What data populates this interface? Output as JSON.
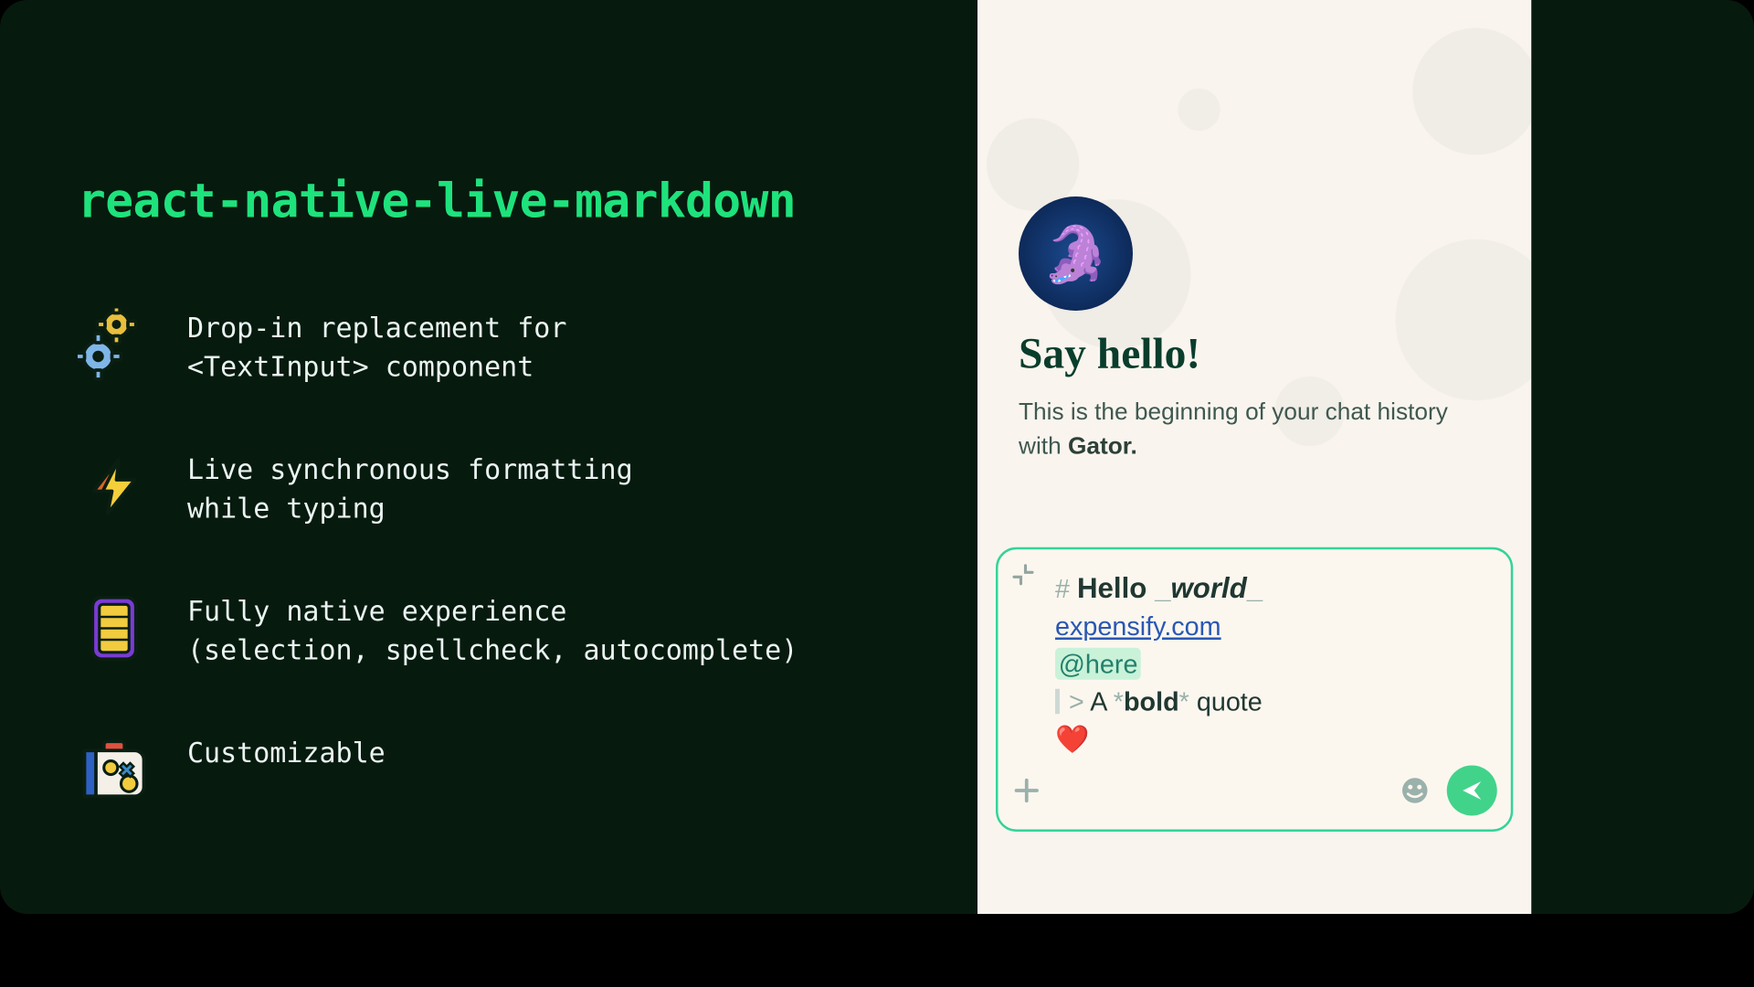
{
  "title": "react-native-live-markdown",
  "features": [
    {
      "icon": "gears-icon",
      "text": "Drop-in replacement for\n<TextInput> component"
    },
    {
      "icon": "lightning-icon",
      "text": "Live synchronous formatting\nwhile typing"
    },
    {
      "icon": "phone-icon",
      "text": "Fully native experience\n(selection, spellcheck, autocomplete)"
    },
    {
      "icon": "suitcase-icon",
      "text": "Customizable"
    }
  ],
  "chat": {
    "greeting_title": "Say hello!",
    "greeting_body_prefix": "This is the beginning of your chat history with ",
    "greeting_body_bold": "Gator.",
    "contact_name": "Gator"
  },
  "composer": {
    "line_heading_hash": "# ",
    "line_heading_text": "Hello ",
    "line_heading_italic_open": "_",
    "line_heading_italic_text": "world",
    "line_heading_italic_close": "_",
    "line_link": "expensify.com",
    "line_mention": "@here",
    "line_quote_gt": "> ",
    "line_quote_prefix": "A ",
    "line_quote_star_open": "*",
    "line_quote_bold": "bold",
    "line_quote_star_close": "*",
    "line_quote_suffix": " quote",
    "line_heart": "❤️"
  },
  "colors": {
    "background": "#071a0e",
    "accent": "#1ee27c",
    "phone_bg": "#f9f5ee",
    "composer_border": "#34d399",
    "link": "#2a57b3",
    "mention_bg": "#c9f2d9",
    "send_bg": "#42d38a"
  }
}
